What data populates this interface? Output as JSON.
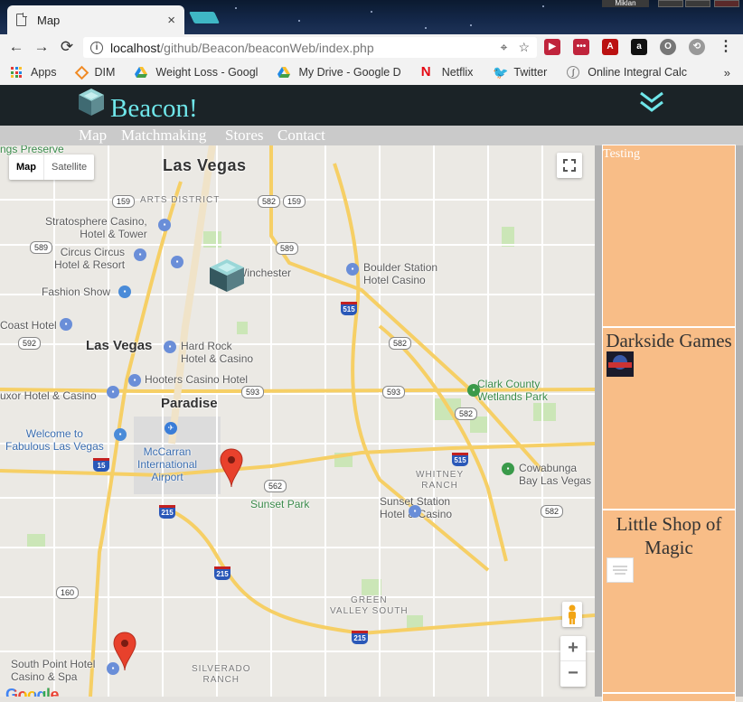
{
  "browser": {
    "tab_title": "Map",
    "tab_close": "×",
    "window_user": "Miklan",
    "url_host": "localhost",
    "url_path": "/github/Beacon/beaconWeb/index.php",
    "nav": {
      "back": "←",
      "forward": "→",
      "reload": "⟳"
    }
  },
  "bookmarks": [
    {
      "label": "Apps",
      "icon": "apps-grid-icon"
    },
    {
      "label": "DIM",
      "icon": "dim-icon"
    },
    {
      "label": "Weight Loss - Googl",
      "icon": "google-drive-icon"
    },
    {
      "label": "My Drive - Google D",
      "icon": "google-drive-icon"
    },
    {
      "label": "Netflix",
      "icon": "netflix-icon"
    },
    {
      "label": "Twitter",
      "icon": "twitter-icon"
    },
    {
      "label": "Online Integral Calc",
      "icon": "calculator-icon"
    }
  ],
  "site": {
    "brand": "Beacon!",
    "menu": [
      "Map",
      "Matchmaking",
      "Stores",
      "Contact"
    ],
    "accent": "#6fe6ea",
    "header_bg": "#1b2327"
  },
  "map": {
    "controls": {
      "map": "Map",
      "satellite": "Satellite",
      "zoom_in": "+",
      "zoom_out": "−"
    },
    "attribution": "Google",
    "labels": {
      "las_vegas_top": "Las Vegas",
      "las_vegas_mid": "Las Vegas",
      "paradise": "Paradise",
      "arts_district": "ARTS DISTRICT",
      "stratosphere": "Stratosphere Casino,\nHotel & Tower",
      "circus_circus": "Circus Circus\nHotel & Resort",
      "fashion_show": "Fashion Show",
      "coast_hotel": "Coast Hotel",
      "winchester": "Winchester",
      "boulder_station": "Boulder Station\nHotel Casino",
      "hard_rock": "Hard Rock\nHotel & Casino",
      "hooters": "Hooters Casino Hotel",
      "luxor": "uxor Hotel & Casino",
      "welcome": "Welcome to\nFabulous Las Vegas",
      "mccarran": "McCarran\nInternational\nAirport",
      "sunset_park": "Sunset Park",
      "whitney_ranch": "WHITNEY\nRANCH",
      "sunset_station": "Sunset Station\nHotel & Casino",
      "cowabunga": "Cowabunga\nBay Las Vegas",
      "clark_county": "Clark County\nWetlands Park",
      "green_valley": "GREEN\nVALLEY SOUTH",
      "silverado": "SILVERADO\nRANCH",
      "south_point": "South Point Hotel\nCasino & Spa",
      "preserve": "ngs Preserve"
    },
    "shields": [
      "159",
      "582",
      "159",
      "589",
      "589",
      "592",
      "582",
      "593",
      "593",
      "582",
      "562",
      "582",
      "160"
    ],
    "interstates": [
      "515",
      "15",
      "215",
      "215",
      "215",
      "515"
    ]
  },
  "stores": [
    {
      "name": "Testing",
      "has_thumb": false
    },
    {
      "name": "Darkside Games",
      "has_thumb": true
    },
    {
      "name": "Little Shop of Magic",
      "has_thumb": true
    }
  ],
  "sidebar_bg": "#f8bd87"
}
